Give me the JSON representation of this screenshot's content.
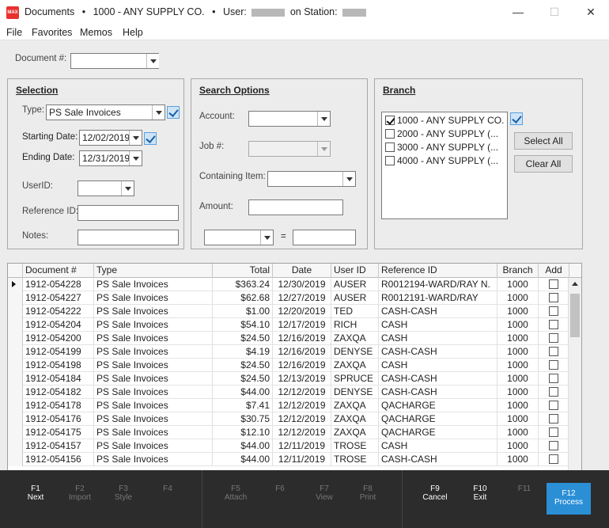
{
  "window": {
    "app_icon_text": "MAX",
    "title": "Documents",
    "bullet": "•",
    "company": "1000 - ANY SUPPLY CO.",
    "user_label": "User:",
    "station_label": "on Station:",
    "minimize": "—",
    "maximize": "☐",
    "close": "✕"
  },
  "menu": [
    "File",
    "Favorites",
    "Memos",
    "Help"
  ],
  "document_number": {
    "label": "Document #:",
    "value": ""
  },
  "selection": {
    "title": "Selection",
    "type_label": "Type:",
    "type_value": "PS Sale Invoices",
    "starting_date_label": "Starting Date:",
    "starting_date": "12/02/2019",
    "ending_date_label": "Ending Date:",
    "ending_date": "12/31/2019",
    "userid_label": "UserID:",
    "userid_value": "",
    "reference_label": "Reference ID:",
    "reference_value": "",
    "notes_label": "Notes:",
    "notes_value": ""
  },
  "search_options": {
    "title": "Search Options",
    "account_label": "Account:",
    "job_label": "Job #:",
    "containing_label": "Containing Item:",
    "amount_label": "Amount:",
    "equals": "="
  },
  "branch": {
    "title": "Branch",
    "items": [
      {
        "label": "1000 - ANY SUPPLY CO.",
        "checked": true
      },
      {
        "label": "2000 - ANY SUPPLY (...",
        "checked": false
      },
      {
        "label": "3000 - ANY SUPPLY (...",
        "checked": false
      },
      {
        "label": "4000 - ANY SUPPLY (...",
        "checked": false
      }
    ],
    "select_all": "Select All",
    "clear_all": "Clear All"
  },
  "grid": {
    "columns": [
      "Document #",
      "Type",
      "Total",
      "Date",
      "User ID",
      "Reference ID",
      "Branch",
      "Add"
    ],
    "rows": [
      [
        "1912-054228",
        "PS Sale Invoices",
        "$363.24",
        "12/30/2019",
        "AUSER",
        "R0012194-WARD/RAY N.",
        "1000"
      ],
      [
        "1912-054227",
        "PS Sale Invoices",
        "$62.68",
        "12/27/2019",
        "AUSER",
        "R0012191-WARD/RAY",
        "1000"
      ],
      [
        "1912-054222",
        "PS Sale Invoices",
        "$1.00",
        "12/20/2019",
        "TED",
        "CASH-CASH",
        "1000"
      ],
      [
        "1912-054204",
        "PS Sale Invoices",
        "$54.10",
        "12/17/2019",
        "RICH",
        "CASH",
        "1000"
      ],
      [
        "1912-054200",
        "PS Sale Invoices",
        "$24.50",
        "12/16/2019",
        "ZAXQA",
        "CASH",
        "1000"
      ],
      [
        "1912-054199",
        "PS Sale Invoices",
        "$4.19",
        "12/16/2019",
        "DENYSE",
        "CASH-CASH",
        "1000"
      ],
      [
        "1912-054198",
        "PS Sale Invoices",
        "$24.50",
        "12/16/2019",
        "ZAXQA",
        "CASH",
        "1000"
      ],
      [
        "1912-054184",
        "PS Sale Invoices",
        "$24.50",
        "12/13/2019",
        "SPRUCE",
        "CASH-CASH",
        "1000"
      ],
      [
        "1912-054182",
        "PS Sale Invoices",
        "$44.00",
        "12/12/2019",
        "DENYSE",
        "CASH-CASH",
        "1000"
      ],
      [
        "1912-054178",
        "PS Sale Invoices",
        "$7.41",
        "12/12/2019",
        "ZAXQA",
        "QACHARGE",
        "1000"
      ],
      [
        "1912-054176",
        "PS Sale Invoices",
        "$30.75",
        "12/12/2019",
        "ZAXQA",
        "QACHARGE",
        "1000"
      ],
      [
        "1912-054175",
        "PS Sale Invoices",
        "$12.10",
        "12/12/2019",
        "ZAXQA",
        "QACHARGE",
        "1000"
      ],
      [
        "1912-054157",
        "PS Sale Invoices",
        "$44.00",
        "12/11/2019",
        "TROSE",
        "CASH",
        "1000"
      ],
      [
        "1912-054156",
        "PS Sale Invoices",
        "$44.00",
        "12/11/2019",
        "TROSE",
        "CASH-CASH",
        "1000"
      ]
    ]
  },
  "function_keys": [
    {
      "key": "F1",
      "label": "Next",
      "enabled": true
    },
    {
      "key": "F2",
      "label": "Import",
      "enabled": false
    },
    {
      "key": "F3",
      "label": "Style",
      "enabled": false
    },
    {
      "key": "F4",
      "label": "",
      "enabled": false
    },
    {
      "key": "F5",
      "label": "Attach",
      "enabled": false
    },
    {
      "key": "F6",
      "label": "",
      "enabled": false
    },
    {
      "key": "F7",
      "label": "View",
      "enabled": false
    },
    {
      "key": "F8",
      "label": "Print",
      "enabled": false
    },
    {
      "key": "F9",
      "label": "Cancel",
      "enabled": true
    },
    {
      "key": "F10",
      "label": "Exit",
      "enabled": true
    },
    {
      "key": "F11",
      "label": "",
      "enabled": false
    },
    {
      "key": "F12",
      "label": "Process",
      "enabled": true,
      "primary": true
    }
  ]
}
